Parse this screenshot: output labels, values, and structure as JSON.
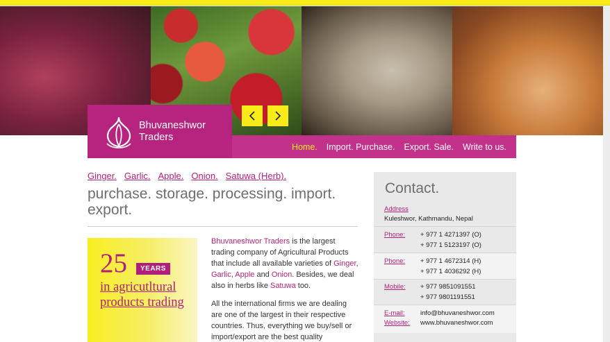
{
  "brand": {
    "line1": "Bhuvaneshwor",
    "line2": "Traders"
  },
  "nav": [
    {
      "label": "Home.",
      "active": true
    },
    {
      "label": "Import. Purchase."
    },
    {
      "label": "Export. Sale."
    },
    {
      "label": "Write to us."
    }
  ],
  "product_links": [
    "Ginger.",
    "Garlic.",
    "Apple.",
    "Onion.",
    "Satuwa (Herb)."
  ],
  "tagline": "purchase. storage. processing. import. export.",
  "years": {
    "number": "25",
    "badge": "YEARS",
    "caption": "in agricutltural products trading"
  },
  "intro": {
    "p1_company": "Bhuvaneshwor Traders",
    "p1_a": " is the largest trading company of Agricultural Products that include all available varieties of ",
    "p1_ginger": "Ginger",
    "p1_c1": ", ",
    "p1_garlic": "Garlic",
    "p1_c2": ", ",
    "p1_apple": "Apple",
    "p1_and": " and ",
    "p1_onion": "Onion",
    "p1_b": ". Besides, we deal also in herbs like ",
    "p1_satuwa": "Satuwa",
    "p1_end": " too.",
    "p2": "All the international firms we are dealing are one of the largest in their respective countries. Thus, everything we buy/sell or import/export are the best quality"
  },
  "contact": {
    "title": "Contact.",
    "address_label": "Address",
    "address_value": "Kuleshwor, Kathmandu, Nepal",
    "phone1_label": "Phone:",
    "phone1_values": [
      "+ 977 1 4271397 (O)",
      "+ 977 1 5123197 (O)"
    ],
    "phone2_label": "Phone:",
    "phone2_values": [
      "+ 977 1 4672314 (H)",
      "+ 977 1 4036292 (H)"
    ],
    "mobile_label": "Mobile:",
    "mobile_values": [
      "+ 977 9851091551",
      "+ 977 9801191551"
    ],
    "email_label": "E-mail:",
    "email_value": "info@bhuvaneshwor.com",
    "website_label": "Website:",
    "website_value": "www.bhuvaneshwor.com"
  },
  "colors": {
    "accent_magenta": "#b7247f",
    "nav_magenta": "#c2318a",
    "accent_yellow": "#f7ec1a"
  }
}
